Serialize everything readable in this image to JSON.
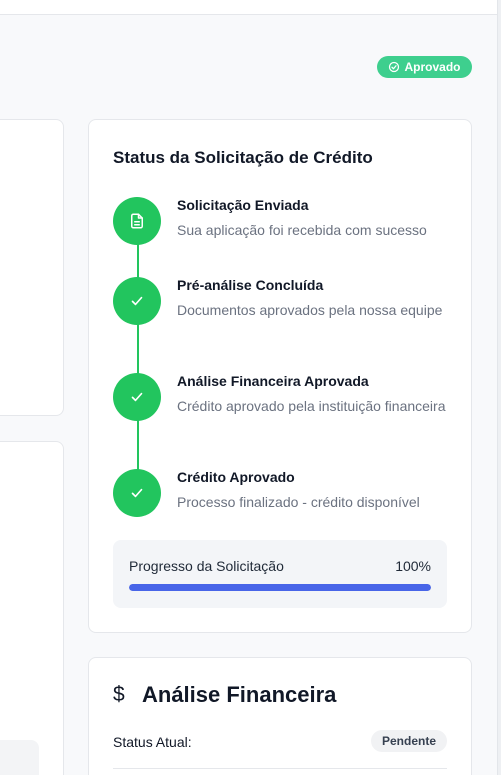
{
  "header": {
    "status_badge": "Aprovado",
    "status_badge_color": "#3ecf8e"
  },
  "credit_status": {
    "title": "Status da Solicitação de Crédito",
    "steps": [
      {
        "title": "Solicitação Enviada",
        "description": "Sua aplicação foi recebida com sucesso",
        "icon": "document-icon"
      },
      {
        "title": "Pré-análise Concluída",
        "description": "Documentos aprovados pela nossa equipe",
        "icon": "check-icon"
      },
      {
        "title": "Análise Financeira Aprovada",
        "description": "Crédito aprovado pela instituição financeira",
        "icon": "check-icon"
      },
      {
        "title": "Crédito Aprovado",
        "description": "Processo finalizado - crédito disponível",
        "icon": "check-icon"
      }
    ],
    "step_color": "#22c55e",
    "progress": {
      "label": "Progresso da Solicitação",
      "value_text": "100%",
      "percent": 100,
      "color": "#4865e8"
    }
  },
  "financial_analysis": {
    "icon": "dollar-icon",
    "title": "Análise Financeira",
    "status_label": "Status Atual:",
    "status_value": "Pendente"
  }
}
